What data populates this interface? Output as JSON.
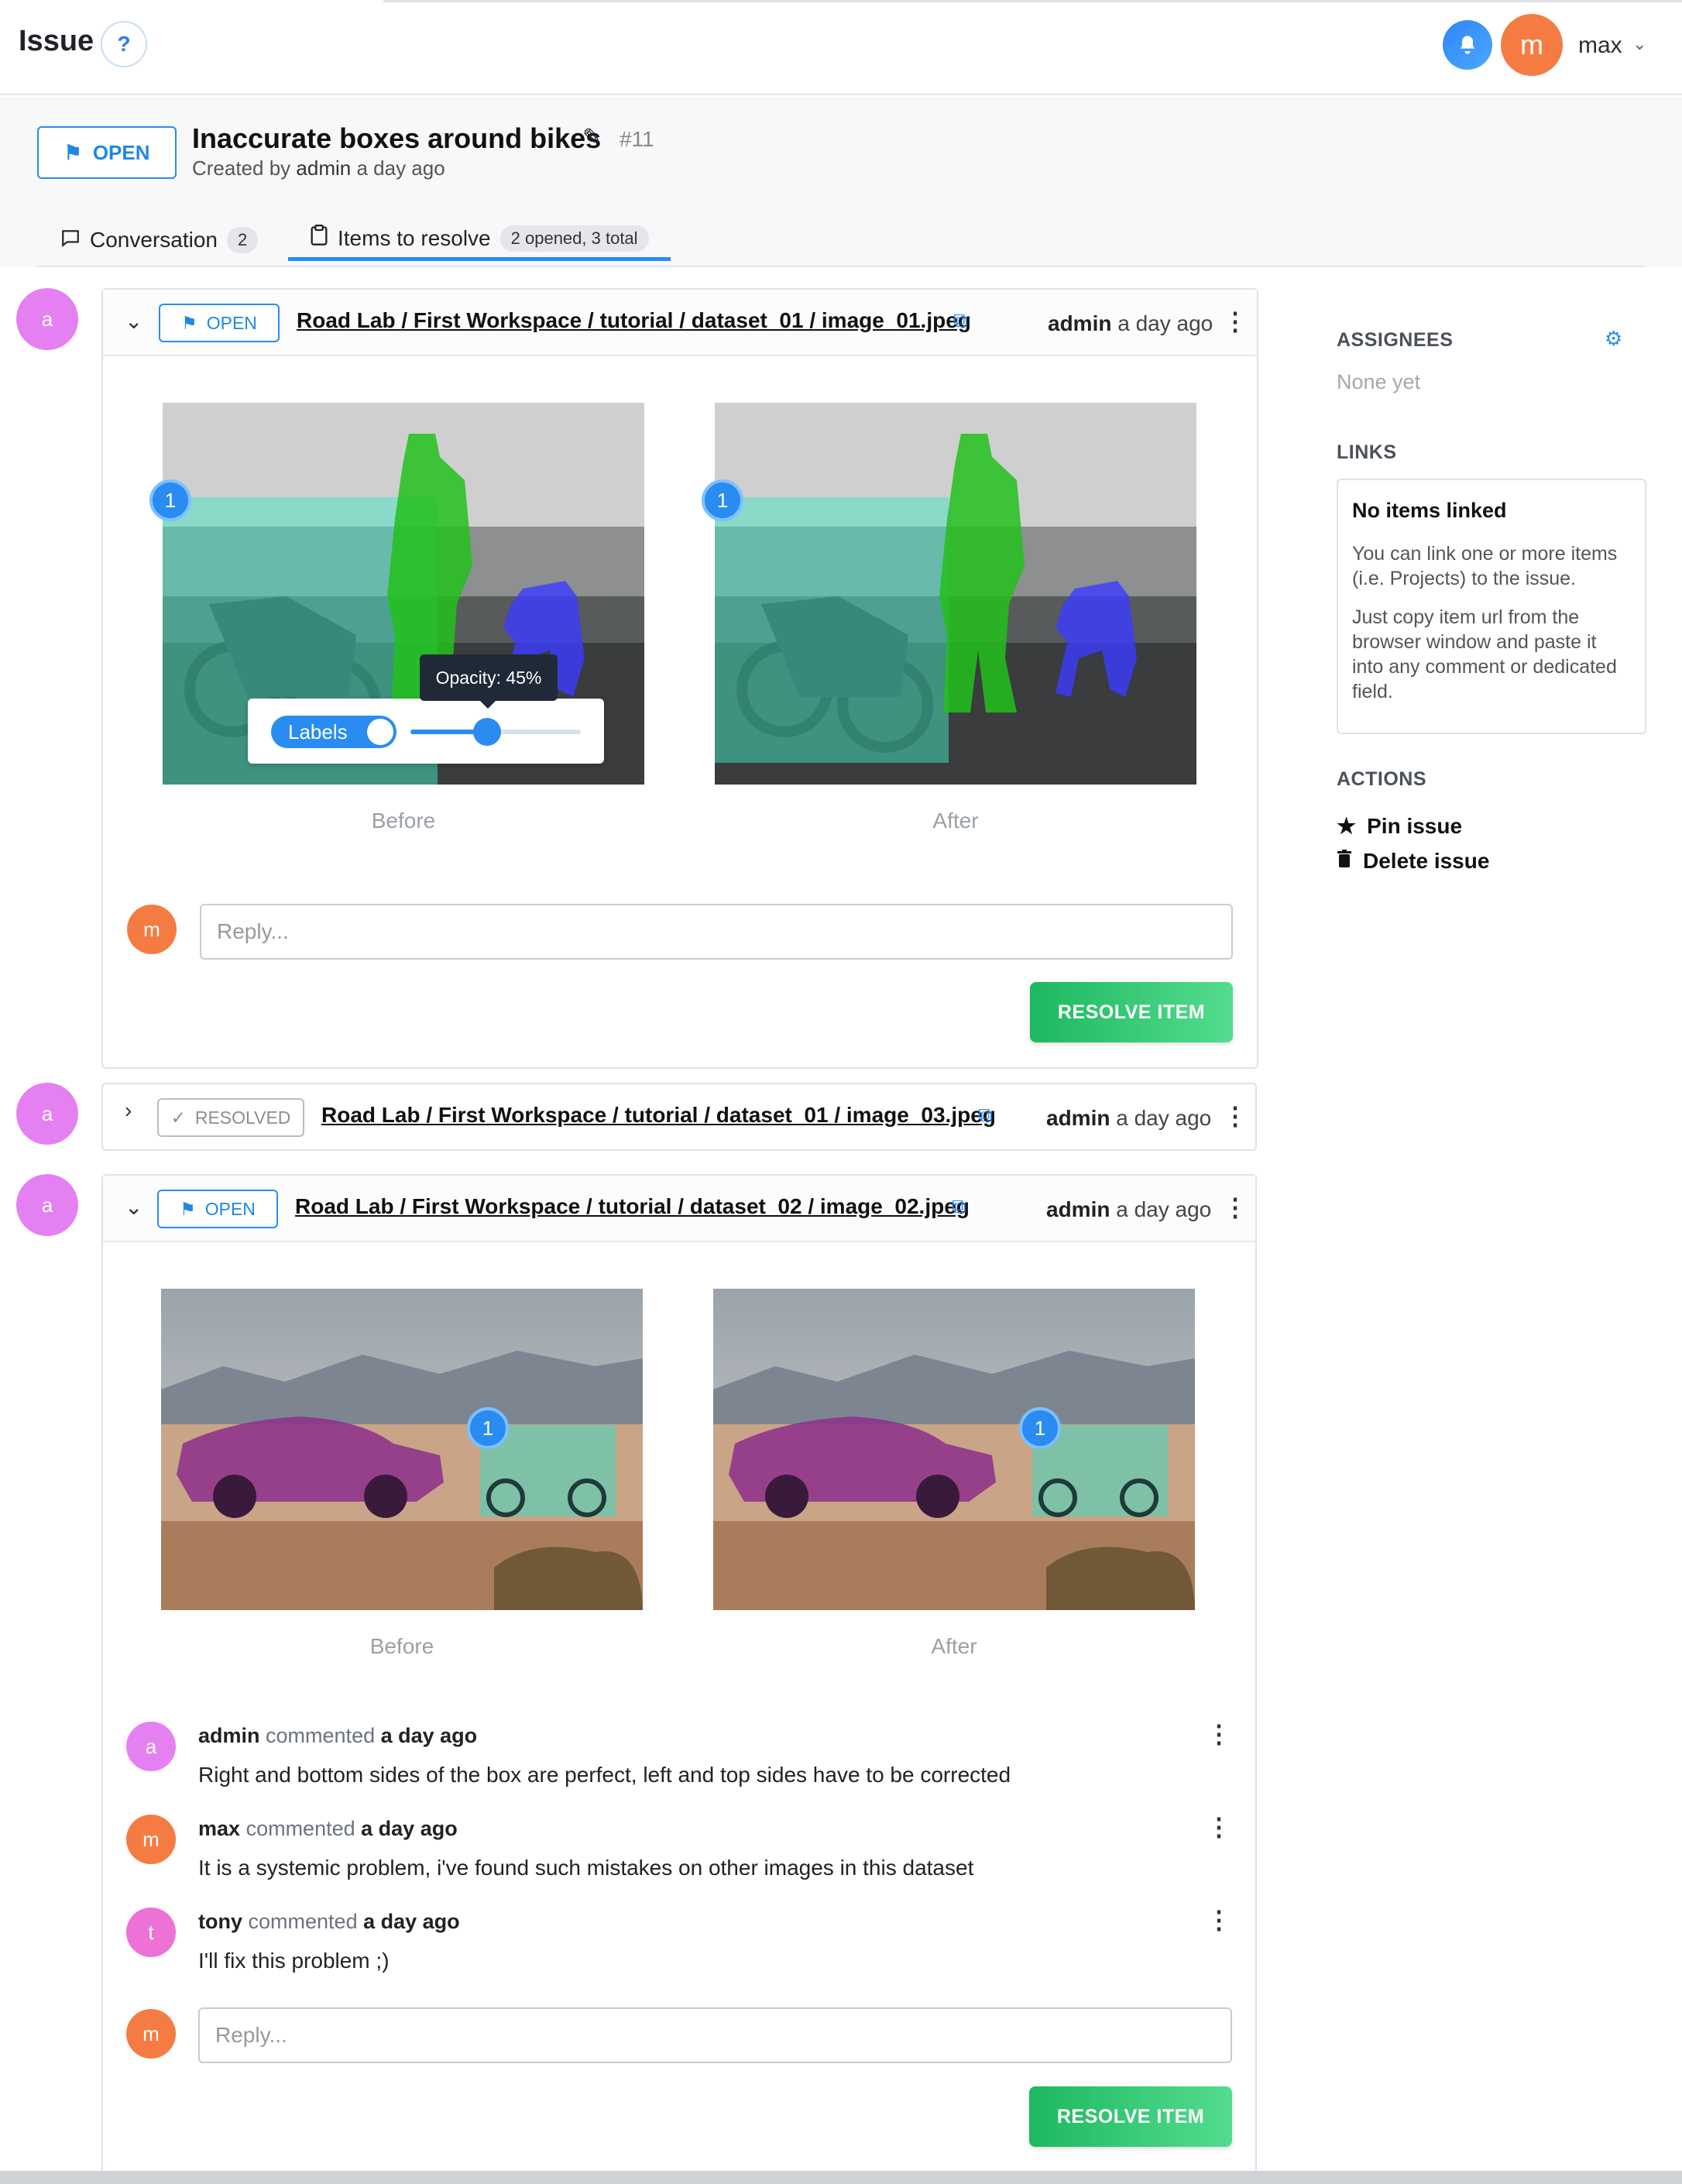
{
  "topbar": {
    "title": "Issue",
    "help_label": "?",
    "user_initial": "m",
    "user_name": "max"
  },
  "issue": {
    "status": "OPEN",
    "title": "Inaccurate boxes around bikes",
    "number": "#11",
    "created_prefix": "Created by",
    "created_by": "admin",
    "created_when": "a day ago"
  },
  "tabs": [
    {
      "label": "Conversation",
      "badge": "2"
    },
    {
      "label": "Items to resolve",
      "badge": "2 opened, 3 total"
    }
  ],
  "items": [
    {
      "avatar": "a",
      "status": "OPEN",
      "path": "Road Lab / First Workspace / tutorial / dataset_01 / image_01.jpeg",
      "author": "admin",
      "when": "a day ago",
      "before_label": "Before",
      "after_label": "After",
      "marker": "1",
      "reply_placeholder": "Reply...",
      "resolve_label": "RESOLVE ITEM"
    },
    {
      "avatar": "a",
      "status": "RESOLVED",
      "path": "Road Lab / First Workspace / tutorial / dataset_01 / image_03.jpeg",
      "author": "admin",
      "when": "a day ago"
    },
    {
      "avatar": "a",
      "status": "OPEN",
      "path": "Road Lab / First Workspace / tutorial / dataset_02 / image_02.jpeg",
      "author": "admin",
      "when": "a day ago",
      "before_label": "Before",
      "after_label": "After",
      "marker": "1",
      "reply_placeholder": "Reply...",
      "resolve_label": "RESOLVE ITEM"
    }
  ],
  "overlay_control": {
    "labels_toggle": "Labels",
    "tooltip": "Opacity: 45%",
    "opacity_value": 0.45
  },
  "comments": [
    {
      "initial": "a",
      "author": "admin",
      "verb": "commented",
      "when": "a day ago",
      "text": "Right and bottom sides of the box are perfect, left and top sides have to be corrected"
    },
    {
      "initial": "m",
      "author": "max",
      "verb": "commented",
      "when": "a day ago",
      "text": "It is a systemic problem, i've found such mistakes on other images in this dataset"
    },
    {
      "initial": "t",
      "author": "tony",
      "verb": "commented",
      "when": "a day ago",
      "text": "I'll fix this problem ;)"
    }
  ],
  "reply_initial": "m",
  "sidebar": {
    "assignees_label": "ASSIGNEES",
    "assignees_value": "None yet",
    "links_label": "LINKS",
    "links_title": "No items linked",
    "links_text1": "You can link one or more items (i.e. Projects) to the issue.",
    "links_text2": "Just copy item url from the browser window and paste it into any comment or dedicated field.",
    "actions_label": "ACTIONS",
    "pin_label": "Pin issue",
    "delete_label": "Delete issue"
  },
  "colors": {
    "accent": "#2a8cf0",
    "resolve_green": "#1db85f",
    "avatar_admin": "#e580f2",
    "avatar_max": "#f47c42",
    "avatar_tony": "#ee71d6"
  }
}
